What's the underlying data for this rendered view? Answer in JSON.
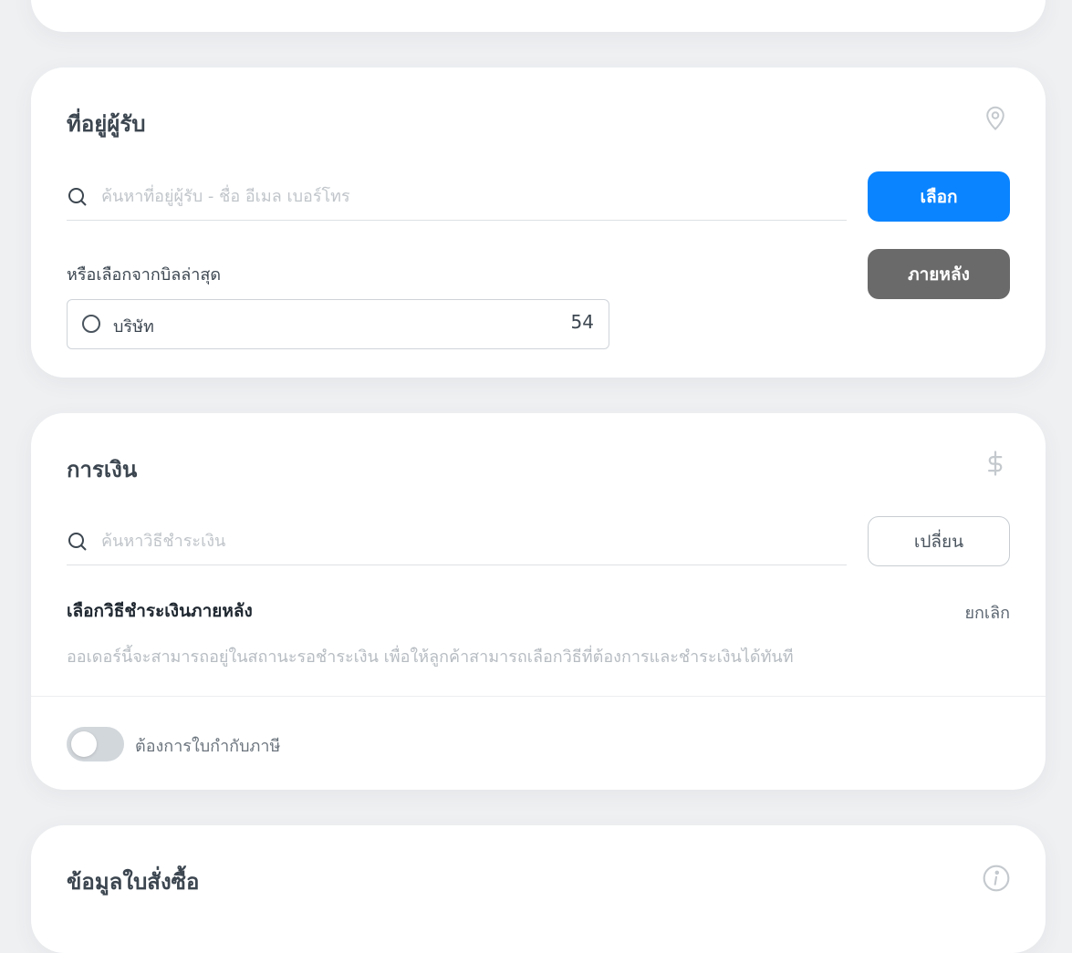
{
  "address_section": {
    "title": "ที่อยู่ผู้รับ",
    "icon": "map-pin-icon",
    "search_placeholder": "ค้นหาที่อยู่ผู้รับ - ชื่อ อีเมล เบอร์โทร",
    "select_button": "เลือก",
    "later_button": "ภายหลัง",
    "recent_label": "หรือเลือกจากบิลล่าสุด",
    "recent_bill": {
      "company": "บริษัท",
      "suffix": "54"
    }
  },
  "finance_section": {
    "title": "การเงิน",
    "icon": "dollar-icon",
    "search_placeholder": "ค้นหาวิธีชำระเงิน",
    "change_button": "เปลี่ยน",
    "pay_later_title": "เลือกวิธีชำระเงินภายหลัง",
    "cancel_label": "ยกเลิก",
    "pay_later_desc": "ออเดอร์นี้จะสามารถอยู่ในสถานะรอชำระเงิน เพื่อให้ลูกค้าสามารถเลือกวิธีที่ต้องการและชำระเงินได้ทันที",
    "tax_invoice_label": "ต้องการใบกำกับภาษี",
    "tax_invoice_enabled": false
  },
  "order_section": {
    "title": "ข้อมูลใบสั่งซื้อ",
    "icon": "info-icon"
  },
  "colors": {
    "primary": "#0a84ff",
    "secondary_button": "#6a6a6a",
    "background": "#eef0f2"
  }
}
